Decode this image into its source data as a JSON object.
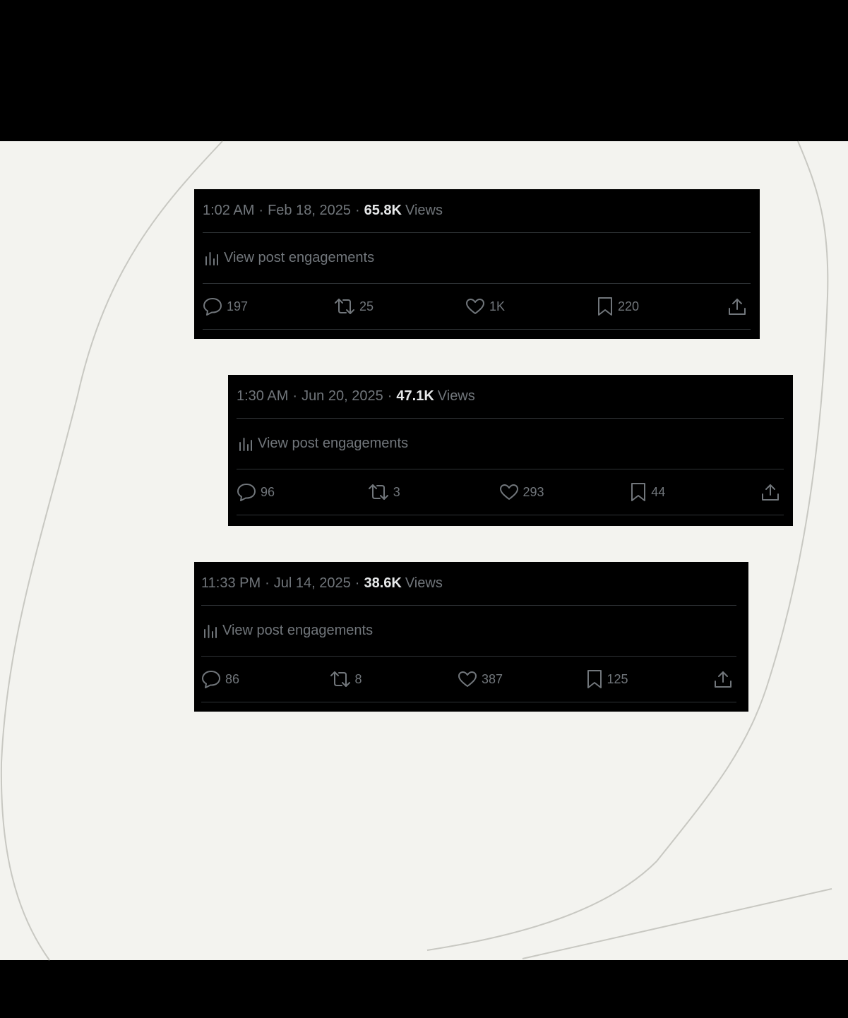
{
  "colors": {
    "card_bg": "#000000",
    "muted": "#71767b",
    "bright": "#e7e9ea",
    "divider": "#2f3336",
    "canvas": "#f3f3ef"
  },
  "icons": [
    "analytics-icon",
    "reply-icon",
    "repost-icon",
    "like-icon",
    "bookmark-icon",
    "share-icon"
  ],
  "posts": [
    {
      "time": "1:02 AM",
      "date": "Feb 18, 2025",
      "views_count": "65.8K",
      "views_label": "Views",
      "engagements_label": "View post engagements",
      "replies": "197",
      "reposts": "25",
      "likes": "1K",
      "bookmarks": "220"
    },
    {
      "time": "1:30 AM",
      "date": "Jun 20, 2025",
      "views_count": "47.1K",
      "views_label": "Views",
      "engagements_label": "View post engagements",
      "replies": "96",
      "reposts": "3",
      "likes": "293",
      "bookmarks": "44"
    },
    {
      "time": "11:33 PM",
      "date": "Jul 14, 2025",
      "views_count": "38.6K",
      "views_label": "Views",
      "engagements_label": "View post engagements",
      "replies": "86",
      "reposts": "8",
      "likes": "387",
      "bookmarks": "125"
    }
  ]
}
